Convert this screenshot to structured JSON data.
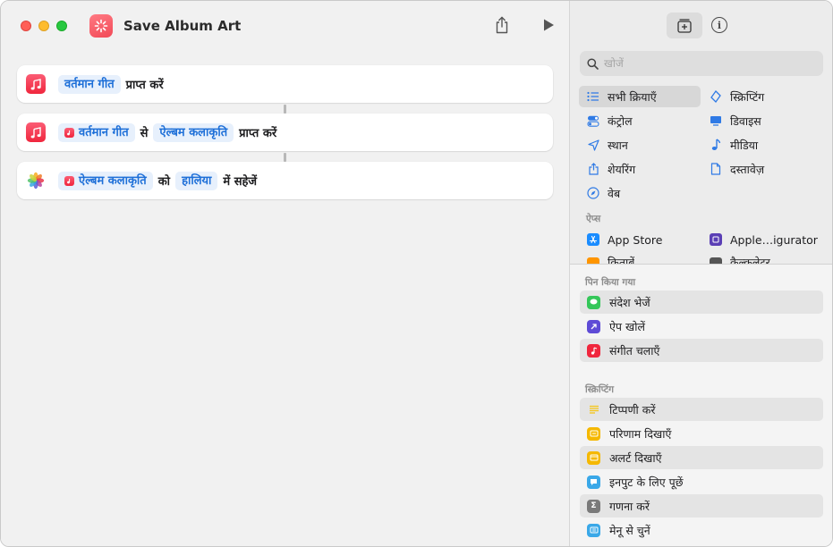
{
  "window": {
    "title": "Save Album Art",
    "accent_color": "#f24a57"
  },
  "toolbar": {
    "share_icon": "share-icon",
    "run_icon": "play-icon"
  },
  "actions": [
    {
      "icon": "music-icon",
      "parts": {
        "t1": "वर्तमान गीत",
        "p1": "प्राप्त करें"
      }
    },
    {
      "icon": "music-icon",
      "parts": {
        "t1": "वर्तमान गीत",
        "p1": "से",
        "t2": "ऐल्बम कलाकृति",
        "p2": "प्राप्त करें"
      }
    },
    {
      "icon": "photos-icon",
      "parts": {
        "t1": "ऐल्बम कलाकृति",
        "p1": "को",
        "t2": "हालिया",
        "p2": "में सहेजें"
      }
    }
  ],
  "library": {
    "search": {
      "placeholder": "खोजें"
    },
    "categories": [
      {
        "label": "सभी क्रियाएँ",
        "icon": "list-icon",
        "selected": true
      },
      {
        "label": "स्क्रिप्टिंग",
        "icon": "scripting-icon"
      },
      {
        "label": "कंट्रोल",
        "icon": "control-icon"
      },
      {
        "label": "डिवाइस",
        "icon": "device-icon"
      },
      {
        "label": "स्थान",
        "icon": "location-icon"
      },
      {
        "label": "मीडिया",
        "icon": "media-icon"
      },
      {
        "label": "शेयरिंग",
        "icon": "sharing-icon"
      },
      {
        "label": "दस्तावेज़",
        "icon": "document-icon"
      },
      {
        "label": "वेब",
        "icon": "web-icon"
      }
    ],
    "apps_header": "ऐप्स",
    "apps": [
      {
        "label": "App Store",
        "color": "#1a8cff"
      },
      {
        "label": "Apple…igurator",
        "color": "#5b3fb5"
      },
      {
        "label": "किताबें",
        "color": "#ff9500"
      },
      {
        "label": "कैल्कुलेटर",
        "color": "#555555"
      }
    ],
    "pinned_header": "पिन किया गया",
    "pinned": [
      {
        "label": "संदेश भेजें",
        "color": "#34c759",
        "icon": "message-icon"
      },
      {
        "label": "ऐप खोलें",
        "color": "#5e4bd6",
        "icon": "open-app-icon"
      },
      {
        "label": "संगीत चलाएँ",
        "color": "#f0263d",
        "icon": "music-icon"
      }
    ],
    "scripting_header": "स्क्रिप्टिंग",
    "scripting": [
      {
        "label": "टिप्पणी करें",
        "color": "#f5c518",
        "icon": "comment-icon"
      },
      {
        "label": "परिणाम दिखाएँ",
        "color": "#f5b800",
        "icon": "show-result-icon"
      },
      {
        "label": "अलर्ट दिखाएँ",
        "color": "#f5b800",
        "icon": "alert-icon"
      },
      {
        "label": "इनपुट के लिए पूछें",
        "color": "#3aa8e8",
        "icon": "ask-input-icon"
      },
      {
        "label": "गणना करें",
        "color": "#7a7a7a",
        "icon": "calculate-icon"
      },
      {
        "label": "मेनू से चुनें",
        "color": "#3aa8e8",
        "icon": "menu-icon"
      }
    ]
  }
}
